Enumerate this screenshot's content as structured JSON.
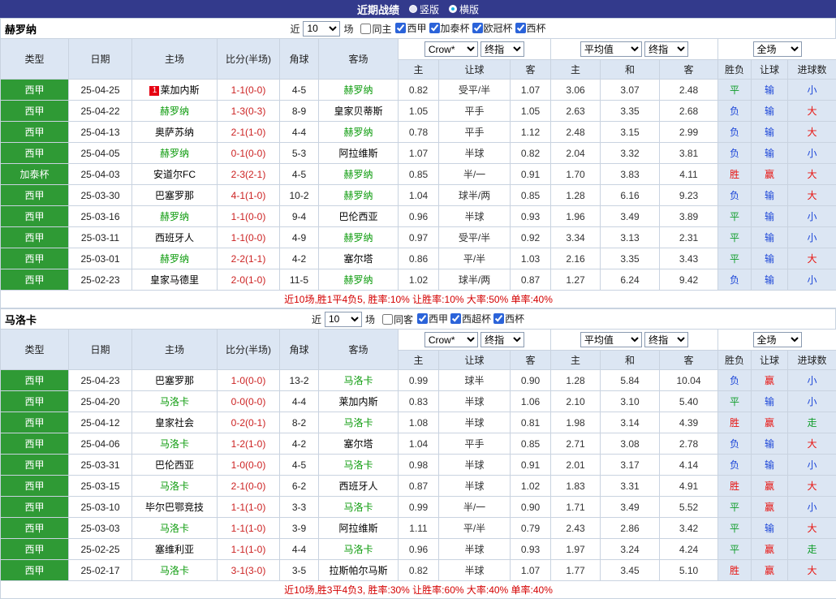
{
  "topbar": {
    "title": "近期战绩",
    "vertical_label": "竖版",
    "horizontal_label": "横版"
  },
  "colors": {
    "topbar_bg": "#333a8c",
    "type_green": "#2f9a35",
    "header_blue": "#dce6f3",
    "score_red": "#cc2222",
    "team_green": "#0a9a0a",
    "summary_red": "#d40000",
    "badge_red": "#e60012"
  },
  "color_map": {
    "胜": "#e8120e",
    "赢": "#e8120e",
    "大": "#e8120e",
    "负": "#1c46d8",
    "输": "#1c46d8",
    "小": "#1c46d8",
    "平": "#0f9d2a",
    "走": "#0f9d2a"
  },
  "columns": {
    "type": "类型",
    "date": "日期",
    "home": "主场",
    "score": "比分(半场)",
    "corner": "角球",
    "away": "客场",
    "sub": [
      "主",
      "让球",
      "客",
      "主",
      "和",
      "客",
      "胜负",
      "让球",
      "进球数"
    ]
  },
  "sections": [
    {
      "team": "赫罗纳",
      "filter": {
        "near_label": "近",
        "count": "10",
        "games_label": "场",
        "same_label": "同主",
        "same_checked": false,
        "leagues": [
          "西甲",
          "加泰杯",
          "欧冠杯",
          "西杯"
        ]
      },
      "selects": {
        "company": "Crow*",
        "company_stage": "终指",
        "avg": "平均值",
        "avg_stage": "终指",
        "scope": "全场"
      },
      "rows": [
        {
          "league": "西甲",
          "date": "25-04-25",
          "home": "莱加内斯",
          "home_badge": "1",
          "home_team": false,
          "score": "1-1(0-0)",
          "corner": "4-5",
          "away": "赫罗纳",
          "away_team": true,
          "odds": [
            "0.82",
            "受平/半",
            "1.07"
          ],
          "avg": [
            "3.06",
            "3.07",
            "2.48"
          ],
          "result": "平",
          "let": "输",
          "goal": "小"
        },
        {
          "league": "西甲",
          "date": "25-04-22",
          "home": "赫罗纳",
          "home_team": true,
          "score": "1-3(0-3)",
          "corner": "8-9",
          "away": "皇家贝蒂斯",
          "away_team": false,
          "odds": [
            "1.05",
            "平手",
            "1.05"
          ],
          "avg": [
            "2.63",
            "3.35",
            "2.68"
          ],
          "result": "负",
          "let": "输",
          "goal": "大"
        },
        {
          "league": "西甲",
          "date": "25-04-13",
          "home": "奥萨苏纳",
          "home_team": false,
          "score": "2-1(1-0)",
          "corner": "4-4",
          "away": "赫罗纳",
          "away_team": true,
          "odds": [
            "0.78",
            "平手",
            "1.12"
          ],
          "avg": [
            "2.48",
            "3.15",
            "2.99"
          ],
          "result": "负",
          "let": "输",
          "goal": "大"
        },
        {
          "league": "西甲",
          "date": "25-04-05",
          "home": "赫罗纳",
          "home_team": true,
          "score": "0-1(0-0)",
          "corner": "5-3",
          "away": "阿拉维斯",
          "away_team": false,
          "odds": [
            "1.07",
            "半球",
            "0.82"
          ],
          "avg": [
            "2.04",
            "3.32",
            "3.81"
          ],
          "result": "负",
          "let": "输",
          "goal": "小"
        },
        {
          "league": "加泰杯",
          "date": "25-04-03",
          "home": "安道尔FC",
          "home_team": false,
          "score": "2-3(2-1)",
          "corner": "4-5",
          "away": "赫罗纳",
          "away_team": true,
          "odds": [
            "0.85",
            "半/一",
            "0.91"
          ],
          "avg": [
            "1.70",
            "3.83",
            "4.11"
          ],
          "result": "胜",
          "let": "赢",
          "goal": "大"
        },
        {
          "league": "西甲",
          "date": "25-03-30",
          "home": "巴塞罗那",
          "home_team": false,
          "score": "4-1(1-0)",
          "corner": "10-2",
          "away": "赫罗纳",
          "away_team": true,
          "odds": [
            "1.04",
            "球半/两",
            "0.85"
          ],
          "avg": [
            "1.28",
            "6.16",
            "9.23"
          ],
          "result": "负",
          "let": "输",
          "goal": "大"
        },
        {
          "league": "西甲",
          "date": "25-03-16",
          "home": "赫罗纳",
          "home_team": true,
          "score": "1-1(0-0)",
          "corner": "9-4",
          "away": "巴伦西亚",
          "away_team": false,
          "odds": [
            "0.96",
            "半球",
            "0.93"
          ],
          "avg": [
            "1.96",
            "3.49",
            "3.89"
          ],
          "result": "平",
          "let": "输",
          "goal": "小"
        },
        {
          "league": "西甲",
          "date": "25-03-11",
          "home": "西班牙人",
          "home_team": false,
          "score": "1-1(0-0)",
          "corner": "4-9",
          "away": "赫罗纳",
          "away_team": true,
          "odds": [
            "0.97",
            "受平/半",
            "0.92"
          ],
          "avg": [
            "3.34",
            "3.13",
            "2.31"
          ],
          "result": "平",
          "let": "输",
          "goal": "小"
        },
        {
          "league": "西甲",
          "date": "25-03-01",
          "home": "赫罗纳",
          "home_team": true,
          "score": "2-2(1-1)",
          "corner": "4-2",
          "away": "塞尔塔",
          "away_team": false,
          "odds": [
            "0.86",
            "平/半",
            "1.03"
          ],
          "avg": [
            "2.16",
            "3.35",
            "3.43"
          ],
          "result": "平",
          "let": "输",
          "goal": "大"
        },
        {
          "league": "西甲",
          "date": "25-02-23",
          "home": "皇家马德里",
          "home_team": false,
          "score": "2-0(1-0)",
          "corner": "11-5",
          "away": "赫罗纳",
          "away_team": true,
          "odds": [
            "1.02",
            "球半/两",
            "0.87"
          ],
          "avg": [
            "1.27",
            "6.24",
            "9.42"
          ],
          "result": "负",
          "let": "输",
          "goal": "小"
        }
      ],
      "summary": "近10场,胜1平4负5, 胜率:10% 让胜率:10% 大率:50% 单率:40%"
    },
    {
      "team": "马洛卡",
      "filter": {
        "near_label": "近",
        "count": "10",
        "games_label": "场",
        "same_label": "同客",
        "same_checked": false,
        "leagues": [
          "西甲",
          "西超杯",
          "西杯"
        ]
      },
      "selects": {
        "company": "Crow*",
        "company_stage": "终指",
        "avg": "平均值",
        "avg_stage": "终指",
        "scope": "全场"
      },
      "rows": [
        {
          "league": "西甲",
          "date": "25-04-23",
          "home": "巴塞罗那",
          "home_team": false,
          "score": "1-0(0-0)",
          "corner": "13-2",
          "away": "马洛卡",
          "away_team": true,
          "odds": [
            "0.99",
            "球半",
            "0.90"
          ],
          "avg": [
            "1.28",
            "5.84",
            "10.04"
          ],
          "result": "负",
          "let": "赢",
          "goal": "小"
        },
        {
          "league": "西甲",
          "date": "25-04-20",
          "home": "马洛卡",
          "home_team": true,
          "score": "0-0(0-0)",
          "corner": "4-4",
          "away": "莱加内斯",
          "away_team": false,
          "odds": [
            "0.83",
            "半球",
            "1.06"
          ],
          "avg": [
            "2.10",
            "3.10",
            "5.40"
          ],
          "result": "平",
          "let": "输",
          "goal": "小"
        },
        {
          "league": "西甲",
          "date": "25-04-12",
          "home": "皇家社会",
          "home_team": false,
          "score": "0-2(0-1)",
          "corner": "8-2",
          "away": "马洛卡",
          "away_team": true,
          "odds": [
            "1.08",
            "半球",
            "0.81"
          ],
          "avg": [
            "1.98",
            "3.14",
            "4.39"
          ],
          "result": "胜",
          "let": "赢",
          "goal": "走"
        },
        {
          "league": "西甲",
          "date": "25-04-06",
          "home": "马洛卡",
          "home_team": true,
          "score": "1-2(1-0)",
          "corner": "4-2",
          "away": "塞尔塔",
          "away_team": false,
          "odds": [
            "1.04",
            "平手",
            "0.85"
          ],
          "avg": [
            "2.71",
            "3.08",
            "2.78"
          ],
          "result": "负",
          "let": "输",
          "goal": "大"
        },
        {
          "league": "西甲",
          "date": "25-03-31",
          "home": "巴伦西亚",
          "home_team": false,
          "score": "1-0(0-0)",
          "corner": "4-5",
          "away": "马洛卡",
          "away_team": true,
          "odds": [
            "0.98",
            "半球",
            "0.91"
          ],
          "avg": [
            "2.01",
            "3.17",
            "4.14"
          ],
          "result": "负",
          "let": "输",
          "goal": "小"
        },
        {
          "league": "西甲",
          "date": "25-03-15",
          "home": "马洛卡",
          "home_team": true,
          "score": "2-1(0-0)",
          "corner": "6-2",
          "away": "西班牙人",
          "away_team": false,
          "odds": [
            "0.87",
            "半球",
            "1.02"
          ],
          "avg": [
            "1.83",
            "3.31",
            "4.91"
          ],
          "result": "胜",
          "let": "赢",
          "goal": "大"
        },
        {
          "league": "西甲",
          "date": "25-03-10",
          "home": "毕尔巴鄂竞技",
          "home_team": false,
          "score": "1-1(1-0)",
          "corner": "3-3",
          "away": "马洛卡",
          "away_team": true,
          "odds": [
            "0.99",
            "半/一",
            "0.90"
          ],
          "avg": [
            "1.71",
            "3.49",
            "5.52"
          ],
          "result": "平",
          "let": "赢",
          "goal": "小"
        },
        {
          "league": "西甲",
          "date": "25-03-03",
          "home": "马洛卡",
          "home_team": true,
          "score": "1-1(1-0)",
          "corner": "3-9",
          "away": "阿拉维斯",
          "away_team": false,
          "odds": [
            "1.11",
            "平/半",
            "0.79"
          ],
          "avg": [
            "2.43",
            "2.86",
            "3.42"
          ],
          "result": "平",
          "let": "输",
          "goal": "大"
        },
        {
          "league": "西甲",
          "date": "25-02-25",
          "home": "塞维利亚",
          "home_team": false,
          "score": "1-1(1-0)",
          "corner": "4-4",
          "away": "马洛卡",
          "away_team": true,
          "odds": [
            "0.96",
            "半球",
            "0.93"
          ],
          "avg": [
            "1.97",
            "3.24",
            "4.24"
          ],
          "result": "平",
          "let": "赢",
          "goal": "走"
        },
        {
          "league": "西甲",
          "date": "25-02-17",
          "home": "马洛卡",
          "home_team": true,
          "score": "3-1(3-0)",
          "corner": "3-5",
          "away": "拉斯帕尔马斯",
          "away_team": false,
          "odds": [
            "0.82",
            "半球",
            "1.07"
          ],
          "avg": [
            "1.77",
            "3.45",
            "5.10"
          ],
          "result": "胜",
          "let": "赢",
          "goal": "大"
        }
      ],
      "summary": "近10场,胜3平4负3, 胜率:30% 让胜率:60% 大率:40% 单率:40%"
    }
  ]
}
